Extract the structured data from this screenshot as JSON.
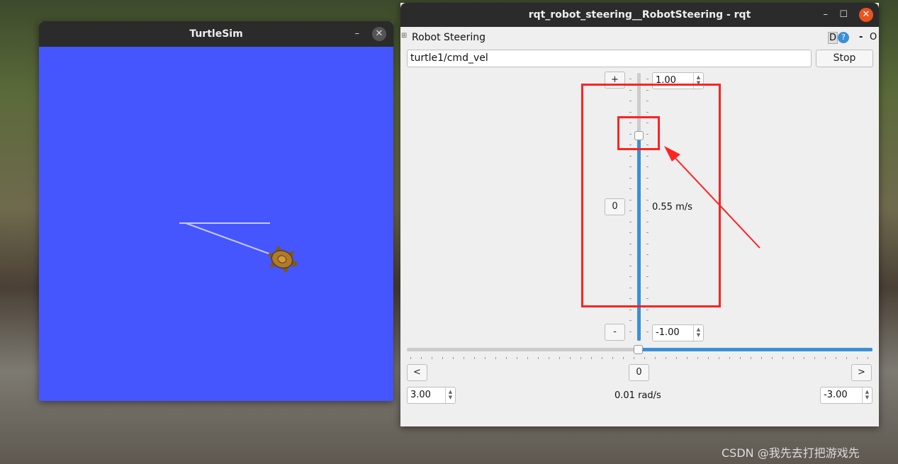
{
  "turtlesim": {
    "title": "TurtleSim",
    "background_color": "#4556ff"
  },
  "rqt": {
    "title": "rqt_robot_steering__RobotSteering - rqt",
    "plugin_label": "Robot Steering",
    "d_label": "D",
    "help_label": "?",
    "dash_label": "-",
    "o_label": "O",
    "topic_value": "turtle1/cmd_vel",
    "stop_label": "Stop",
    "linear": {
      "plus_label": "+",
      "minus_label": "-",
      "zero_label": "0",
      "max_value": "1.00",
      "min_value": "-1.00",
      "current_label": "0.55 m/s",
      "value": 0.55,
      "range": [
        -1,
        1
      ]
    },
    "angular": {
      "left_label": "<",
      "right_label": ">",
      "zero_label": "0",
      "max_value": "3.00",
      "min_value": "-3.00",
      "current_label": "0.01 rad/s",
      "value": 0.01,
      "range": [
        -3,
        3
      ]
    },
    "accent_color": "#3d8fd6"
  },
  "watermark": "CSDN @我先去打把游戏先",
  "annotation_color": "#ff2222"
}
